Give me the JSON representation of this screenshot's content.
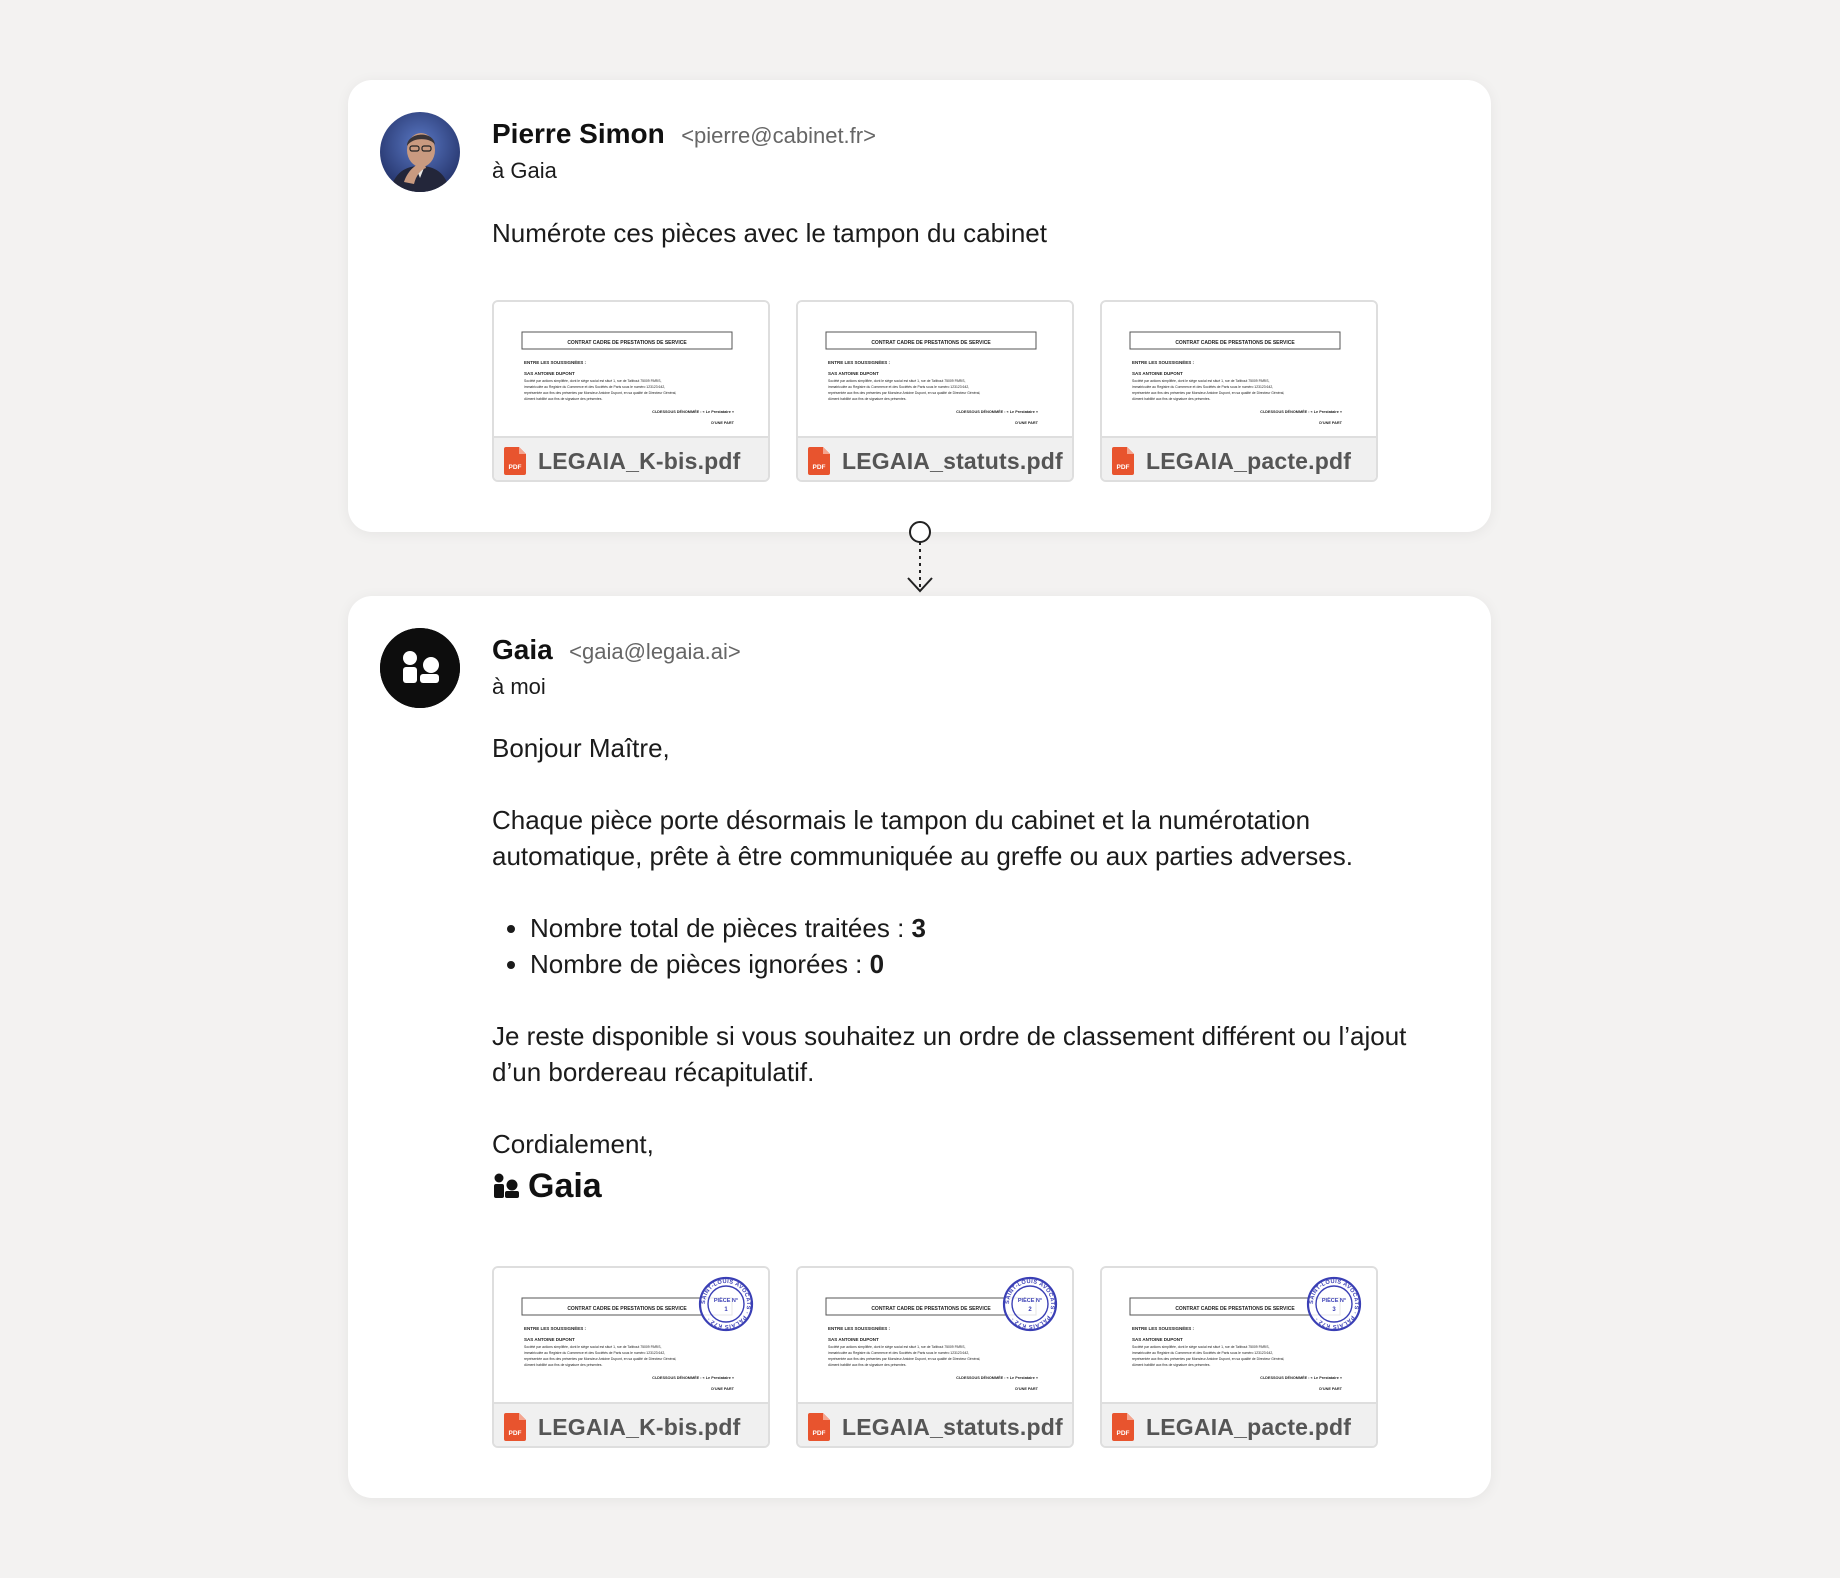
{
  "request": {
    "sender_name": "Pierre Simon",
    "sender_email": "<pierre@cabinet.fr>",
    "recipient": "à Gaia",
    "message": "Numérote ces pièces avec le tampon du cabinet",
    "attachments": [
      {
        "file_name": "LEGAIA_K-bis.pdf",
        "stamped": false
      },
      {
        "file_name": "LEGAIA_statuts.pdf",
        "stamped": false
      },
      {
        "file_name": "LEGAIA_pacte.pdf",
        "stamped": false
      }
    ]
  },
  "reply": {
    "sender_name": "Gaia",
    "sender_email": "<gaia@legaia.ai>",
    "recipient": "à moi",
    "greeting": "Bonjour Maître,",
    "paragraph1": "Chaque pièce porte désormais le tampon du cabinet et la numérotation automatique, prête à être communiquée au greffe ou aux parties adverses.",
    "stats": [
      {
        "label": "Nombre total de pièces traitées : ",
        "value": "3"
      },
      {
        "label": "Nombre de pièces ignorées : ",
        "value": "0"
      }
    ],
    "paragraph2": "Je reste disponible si vous souhaitez un ordre de classement différent ou l’ajout d’un bordereau récapitulatif.",
    "closing": "Cordialement,",
    "signature": "Gaia",
    "attachments": [
      {
        "file_name": "LEGAIA_K-bis.pdf",
        "stamped": true
      },
      {
        "file_name": "LEGAIA_statuts.pdf",
        "stamped": true
      },
      {
        "file_name": "LEGAIA_pacte.pdf",
        "stamped": true
      }
    ]
  },
  "thumbnail_doc": {
    "title": "CONTRAT CADRE DE PRESTATIONS DE SERVICE",
    "parties_heading": "ENTRE LES SOUSSIGNÉES :",
    "party_name": "SAS ANTOINE DUPONT",
    "body_lines": [
      "Société par actions simplifiée, dont le siège social est situé 1, rue de Taitbout 75009 PARIS,",
      "immatriculée au Registre du Commerce et des Sociétés de Paris sous le numéro 123123 642,",
      "représentée aux fins des présentes par Monsieur Antoine Dupont, en sa qualité de Directeur Général,",
      "dûment habilité aux fins de signature des présentes."
    ],
    "designation": "CI-DESSOUS DÉNOMMÉE : « Le Prestataire »",
    "side": "D'UNE PART"
  },
  "stamp": {
    "ring_text": "SAINT-LOUIS AVOCATS · PALAIS K72 ·",
    "label": "PIÈCE N°",
    "color": "#3a3fb5"
  },
  "icons": {
    "pdf": "pdf-file-icon",
    "gaia": "gaia-logo-icon",
    "connector": "arrow-down-icon"
  },
  "colors": {
    "pdf_icon": "#e8542e",
    "gaia_avatar_bg": "#0d0d0d"
  }
}
